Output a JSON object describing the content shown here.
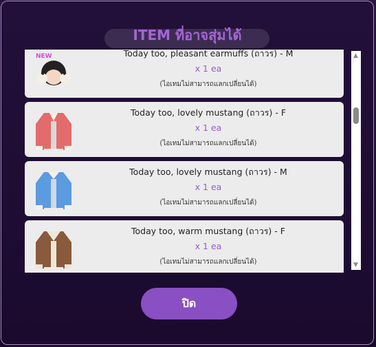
{
  "modal": {
    "title": "ITEM ที่อาจสุ่มได้",
    "close_label": "ปิด"
  },
  "items": [
    {
      "name": "Today too, pleasant earmuffs (ถาวร) - M",
      "qty": "x 1 ea",
      "note": "(ไอเทมไม่สามารถแลกเปลี่ยนได้)",
      "icon": "earmuffs-avatar-icon",
      "badge": "NEW"
    },
    {
      "name": "Today too, lovely mustang (ถาวร) - F",
      "qty": "x 1 ea",
      "note": "(ไอเทมไม่สามารถแลกเปลี่ยนได้)",
      "icon": "red-jacket-icon"
    },
    {
      "name": "Today too, lovely mustang (ถาวร) - M",
      "qty": "x 1 ea",
      "note": "(ไอเทมไม่สามารถแลกเปลี่ยนได้)",
      "icon": "blue-jacket-icon"
    },
    {
      "name": "Today too, warm mustang (ถาวร) - F",
      "qty": "x 1 ea",
      "note": "(ไอเทมไม่สามารถแลกเปลี่ยนได้)",
      "icon": "brown-jacket-icon"
    }
  ],
  "colors": {
    "title": "#a565d6",
    "qty": "#9a5bc9",
    "button": "#8a4fc2",
    "card": "#ececec"
  }
}
